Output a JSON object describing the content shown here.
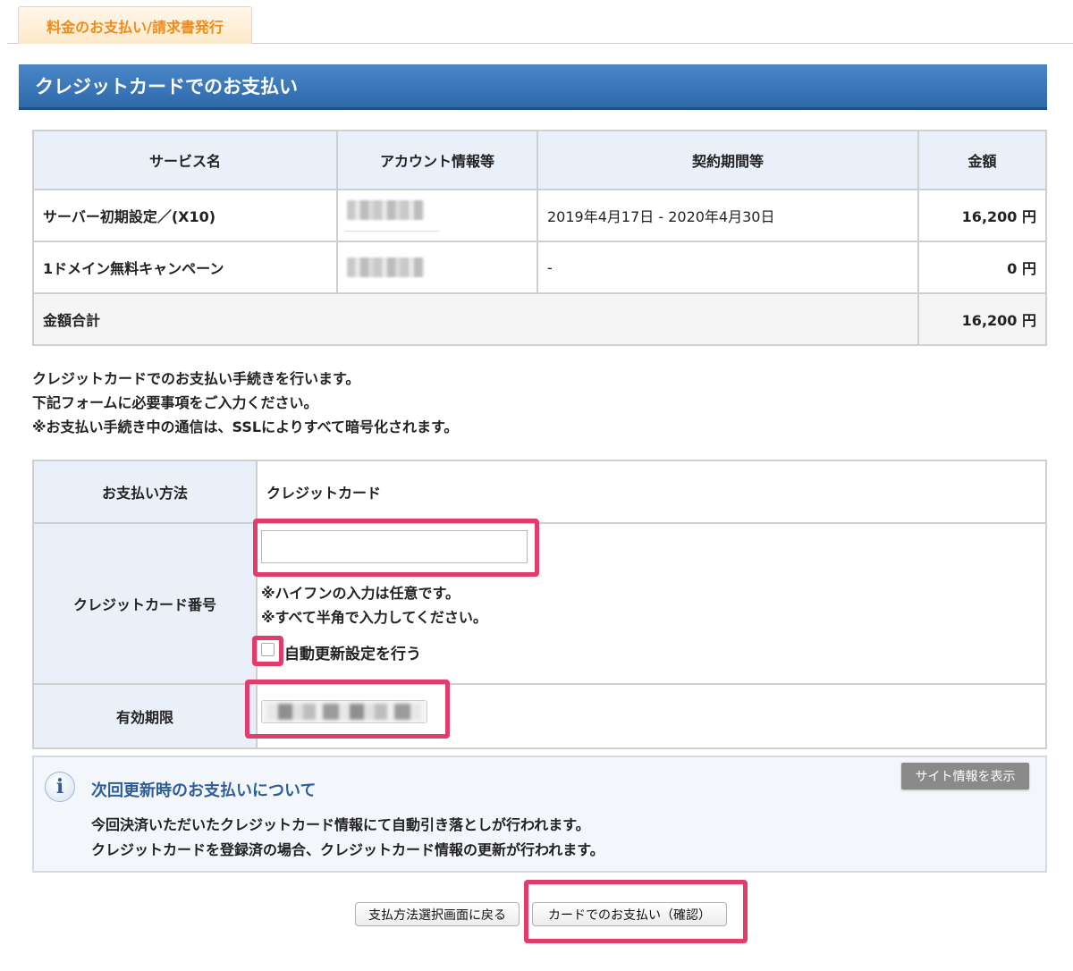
{
  "tab": {
    "label": "料金のお支払い/請求書発行"
  },
  "header": {
    "title": "クレジットカードでのお支払い"
  },
  "service_table": {
    "columns": [
      "サービス名",
      "アカウント情報等",
      "契約期間等",
      "金額"
    ],
    "rows": [
      {
        "service": "サーバー初期設定／(X10)",
        "period": "2019年4月17日 - 2020年4月30日",
        "amount": "16,200 円"
      },
      {
        "service": "1ドメイン無料キャンペーン",
        "period": "-",
        "amount": "0 円"
      }
    ],
    "total_label": "金額合計",
    "total_amount": "16,200 円"
  },
  "intro": [
    "クレジットカードでのお支払い手続きを行います。",
    "下記フォームに必要事項をご入力ください。",
    "※お支払い手続き中の通信は、SSLによりすべて暗号化されます。"
  ],
  "form": {
    "method_label": "お支払い方法",
    "method_value": "クレジットカード",
    "card_label": "クレジットカード番号",
    "card_value": "",
    "card_note1": "※ハイフンの入力は任意です。",
    "card_note2": "※すべて半角で入力してください。",
    "auto_renew_label": "自動更新設定を行う",
    "expiry_label": "有効期限"
  },
  "info": {
    "title": "次回更新時のお支払いについて",
    "line1": "今回決済いただいたクレジットカード情報にて自動引き落としが行われます。",
    "line2": "クレジットカードを登録済の場合、クレジットカード情報の更新が行われます。",
    "site_button": "サイト情報を表示"
  },
  "buttons": {
    "back": "支払方法選択画面に戻る",
    "confirm": "カードでのお支払い（確認）"
  },
  "colors": {
    "header_blue": "#2d69ab",
    "highlight": "#e23c6d",
    "tab_orange": "#f08a18"
  }
}
